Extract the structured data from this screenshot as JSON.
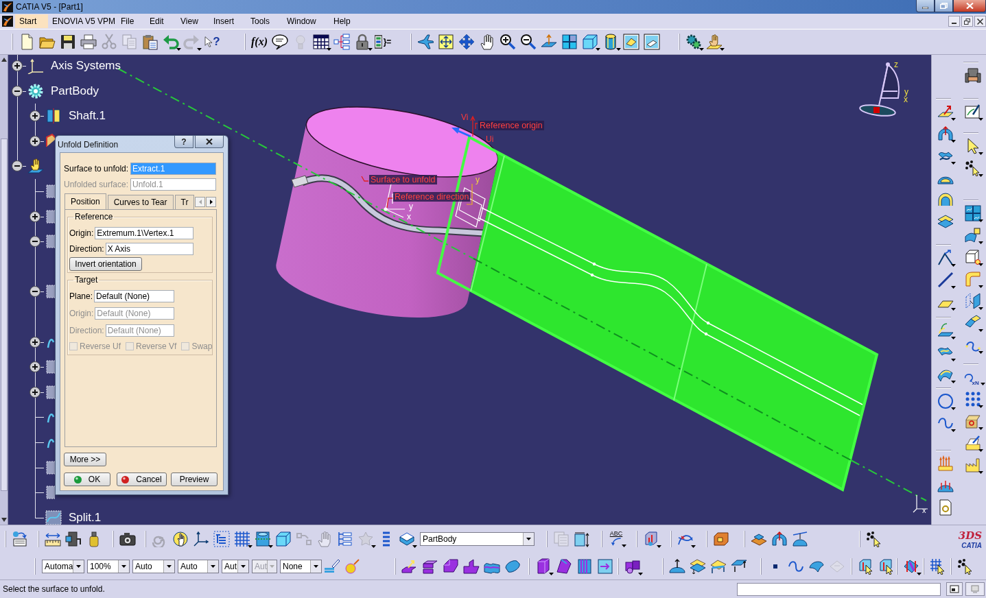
{
  "window": {
    "title": "CATIA V5 - [Part1]"
  },
  "menu": [
    {
      "label": "Start",
      "selected": true
    },
    {
      "label": "ENOVIA V5 VPM",
      "selected": false
    },
    {
      "label": "File",
      "selected": false
    },
    {
      "label": "Edit",
      "selected": false
    },
    {
      "label": "View",
      "selected": false
    },
    {
      "label": "Insert",
      "selected": false
    },
    {
      "label": "Tools",
      "selected": false
    },
    {
      "label": "Window",
      "selected": false
    },
    {
      "label": "Help",
      "selected": false
    }
  ],
  "top_toolbar": [
    {
      "tools": [
        {
          "kind": "new",
          "disabled": false,
          "dropdown": false
        },
        {
          "kind": "open",
          "disabled": false,
          "dropdown": false
        },
        {
          "kind": "save",
          "disabled": false,
          "dropdown": false
        },
        {
          "kind": "print",
          "disabled": false,
          "dropdown": false
        },
        {
          "kind": "cut",
          "disabled": true,
          "dropdown": false
        },
        {
          "kind": "copy",
          "disabled": true,
          "dropdown": false
        },
        {
          "kind": "paste",
          "disabled": false,
          "dropdown": false
        },
        {
          "kind": "undo",
          "disabled": false,
          "dropdown": true
        },
        {
          "kind": "redo",
          "disabled": true,
          "dropdown": true
        },
        {
          "kind": "whatsthis",
          "label": "?",
          "disabled": false,
          "dropdown": false
        }
      ]
    },
    {
      "tools": [
        {
          "kind": "formula",
          "label": "f(x)",
          "disabled": false,
          "dropdown": false
        },
        {
          "kind": "comment",
          "disabled": false,
          "dropdown": false
        },
        {
          "kind": "bulb",
          "disabled": true,
          "dropdown": false
        },
        {
          "kind": "table",
          "disabled": false,
          "dropdown": true
        },
        {
          "kind": "tree",
          "disabled": false,
          "dropdown": false
        },
        {
          "kind": "lock",
          "disabled": false,
          "dropdown": true
        },
        {
          "kind": "equation",
          "label": "}=",
          "disabled": false,
          "dropdown": false
        }
      ]
    },
    {
      "tools": [
        {
          "kind": "fly",
          "disabled": false,
          "dropdown": false
        },
        {
          "kind": "fit",
          "disabled": false,
          "dropdown": false
        },
        {
          "kind": "pan",
          "disabled": false,
          "dropdown": false
        },
        {
          "kind": "rotate",
          "disabled": false,
          "dropdown": false
        },
        {
          "kind": "zoomin",
          "disabled": false,
          "dropdown": false
        },
        {
          "kind": "zoomout",
          "disabled": false,
          "dropdown": false
        },
        {
          "kind": "normal",
          "disabled": false,
          "dropdown": false
        },
        {
          "kind": "views",
          "disabled": false,
          "dropdown": false
        },
        {
          "kind": "iso",
          "disabled": false,
          "dropdown": true
        },
        {
          "kind": "shade",
          "disabled": false,
          "dropdown": true
        },
        {
          "kind": "hide",
          "disabled": false,
          "dropdown": false
        },
        {
          "kind": "swap",
          "disabled": false,
          "dropdown": false
        }
      ]
    },
    {
      "tools": [
        {
          "kind": "gears",
          "disabled": false,
          "dropdown": true
        },
        {
          "kind": "handsheet",
          "disabled": false,
          "dropdown": true
        }
      ]
    }
  ],
  "tree": {
    "items": [
      {
        "kind": "axes",
        "label": "Axis Systems",
        "expanded": false
      },
      {
        "kind": "body",
        "label": "PartBody",
        "expanded": true,
        "children": [
          {
            "kind": "shaft",
            "label": "Shaft.1",
            "expanded": false
          },
          {
            "kind": "feature",
            "expanded": false
          }
        ]
      },
      {
        "kind": "geoset",
        "expanded": true,
        "children": [
          {
            "kind": "surface"
          },
          {
            "kind": "surface",
            "expanded": false
          },
          {
            "kind": "surface",
            "expanded": true
          },
          {
            "kind": "surface",
            "expanded": true
          },
          {
            "kind": "curve",
            "expanded": false
          },
          {
            "kind": "surface",
            "expanded": false
          },
          {
            "kind": "surface",
            "expanded": false
          },
          {
            "kind": "curve"
          },
          {
            "kind": "curve"
          },
          {
            "kind": "surface"
          },
          {
            "kind": "surface"
          },
          {
            "kind": "split",
            "label": "Split.1"
          }
        ]
      }
    ]
  },
  "viewport": {
    "annotations": [
      "Reference origin",
      "Surface to unfold",
      "Reference direction"
    ],
    "axis_labels": [
      "Vi",
      "Ui",
      "y",
      "y",
      "x"
    ],
    "compass": [
      "z",
      "y",
      "x"
    ],
    "corner_axis": [
      "x"
    ]
  },
  "dialog": {
    "title": "Unfold Definition",
    "help_button": "?",
    "fields": [
      {
        "label": "Surface to unfold:",
        "value": "Extract.1",
        "selected": true,
        "disabled": false
      },
      {
        "label": "Unfolded surface:",
        "value": "Unfold.1",
        "selected": false,
        "disabled": true
      }
    ],
    "tabs": [
      {
        "label": "Position",
        "selected": true
      },
      {
        "label": "Curves to Tear",
        "selected": false
      },
      {
        "label": "Tr",
        "selected": false
      }
    ],
    "tab_scroll": [
      {
        "kind": "left",
        "disabled": true
      },
      {
        "kind": "right",
        "disabled": false
      }
    ],
    "reference": {
      "title": "Reference",
      "fields": [
        {
          "label": "Origin:",
          "value": "Extremum.1\\Vertex.1",
          "disabled": false
        },
        {
          "label": "Direction:",
          "value": "X Axis",
          "disabled": false
        }
      ],
      "button": "Invert orientation"
    },
    "target": {
      "title": "Target",
      "fields": [
        {
          "label": "Plane:",
          "value": "Default (None)",
          "disabled": false
        },
        {
          "label": "Origin:",
          "value": "Default (None)",
          "disabled": true
        },
        {
          "label": "Direction:",
          "value": "Default (None)",
          "disabled": true
        }
      ],
      "checkboxes": [
        {
          "label": "Reverse Uf",
          "checked": false,
          "disabled": true
        },
        {
          "label": "Reverse Vf",
          "checked": false,
          "disabled": true
        },
        {
          "label": "Swap",
          "checked": false,
          "disabled": true
        }
      ]
    },
    "more_button": "More >>",
    "buttons": [
      {
        "label": "OK",
        "kind": "ok"
      },
      {
        "label": "Cancel",
        "kind": "cancel"
      },
      {
        "label": "Preview",
        "kind": "preview"
      }
    ]
  },
  "right_toolbar": {
    "columns": [
      [
        {
          "tools": [
            {
              "kind": "extrude",
              "disabled": false,
              "dropdown": true
            },
            {
              "kind": "revolve",
              "disabled": false,
              "dropdown": true
            },
            {
              "kind": "sweep",
              "disabled": false,
              "dropdown": true
            },
            {
              "kind": "dome",
              "disabled": false,
              "dropdown": false
            },
            {
              "kind": "offset",
              "disabled": false,
              "dropdown": false
            },
            {
              "kind": "stack",
              "disabled": false,
              "dropdown": false
            }
          ]
        },
        {
          "tools": [
            {
              "kind": "vertex",
              "disabled": false,
              "dropdown": true
            },
            {
              "kind": "line",
              "disabled": false,
              "dropdown": true
            },
            {
              "kind": "plane",
              "disabled": false,
              "dropdown": true
            }
          ]
        },
        {
          "tools": [
            {
              "kind": "project",
              "disabled": false,
              "dropdown": true
            },
            {
              "kind": "blend",
              "disabled": false,
              "dropdown": true
            },
            {
              "kind": "fill",
              "disabled": false,
              "dropdown": true
            }
          ]
        },
        {
          "tools": [
            {
              "kind": "circle",
              "disabled": false,
              "dropdown": true
            },
            {
              "kind": "spline",
              "disabled": false,
              "dropdown": true
            }
          ]
        },
        {
          "tools": [
            {
              "kind": "spikes",
              "disabled": false,
              "dropdown": false
            },
            {
              "kind": "domespikes",
              "disabled": false,
              "dropdown": false
            },
            {
              "kind": "report",
              "disabled": false,
              "dropdown": false
            }
          ]
        }
      ],
      [
        {
          "tools": [
            {
              "kind": "chair",
              "disabled": false,
              "dropdown": false
            }
          ]
        },
        {
          "tools": [
            {
              "kind": "sketch",
              "disabled": false,
              "dropdown": true
            }
          ]
        },
        {
          "tools": [
            {
              "kind": "select",
              "disabled": false,
              "dropdown": true
            },
            {
              "kind": "scatter",
              "disabled": false,
              "dropdown": true
            }
          ]
        },
        {
          "tools": [
            {
              "kind": "quad",
              "disabled": false,
              "dropdown": true
            },
            {
              "kind": "flagsheet",
              "disabled": false,
              "dropdown": true
            },
            {
              "kind": "cubetool",
              "disabled": false,
              "dropdown": true
            },
            {
              "kind": "bentsheet",
              "disabled": false,
              "dropdown": true
            },
            {
              "kind": "splitsheet",
              "disabled": false,
              "dropdown": true
            },
            {
              "kind": "joinsheet",
              "disabled": false,
              "dropdown": true
            },
            {
              "kind": "curve",
              "disabled": false,
              "dropdown": true
            }
          ]
        },
        {
          "tools": [
            {
              "kind": "repeat",
              "label": "xN",
              "disabled": false,
              "dropdown": true
            },
            {
              "kind": "dotgrid",
              "disabled": false,
              "dropdown": true
            },
            {
              "kind": "package",
              "disabled": false,
              "dropdown": true
            },
            {
              "kind": "tray",
              "disabled": false,
              "dropdown": true
            },
            {
              "kind": "factory",
              "disabled": false,
              "dropdown": true
            }
          ]
        }
      ]
    ]
  },
  "bottom_toolbar": {
    "rows": [
      [
        {
          "tools": [
            {
              "kind": "transfer",
              "disabled": false,
              "dropdown": false
            }
          ]
        },
        {
          "tools": [
            {
              "kind": "ruler",
              "disabled": false,
              "dropdown": false
            },
            {
              "kind": "inertia",
              "disabled": false,
              "dropdown": false
            },
            {
              "kind": "weight",
              "disabled": false,
              "dropdown": false
            }
          ]
        },
        {
          "tools": [
            {
              "kind": "camera",
              "disabled": false,
              "dropdown": false
            }
          ]
        },
        {
          "tools": [
            {
              "kind": "spiral",
              "disabled": true,
              "dropdown": false
            },
            {
              "kind": "handglobe",
              "disabled": false,
              "dropdown": false
            },
            {
              "kind": "axes",
              "disabled": false,
              "dropdown": false
            },
            {
              "kind": "specs",
              "disabled": false,
              "dropdown": false
            },
            {
              "kind": "grid",
              "disabled": false,
              "dropdown": true
            },
            {
              "kind": "cylframe",
              "disabled": false,
              "dropdown": true
            },
            {
              "kind": "iso",
              "disabled": false,
              "dropdown": false
            },
            {
              "kind": "constraint",
              "disabled": true,
              "dropdown": false
            },
            {
              "kind": "rotate",
              "disabled": true,
              "dropdown": false
            },
            {
              "kind": "treelist",
              "disabled": false,
              "dropdown": false
            },
            {
              "kind": "star",
              "disabled": true,
              "dropdown": true
            },
            {
              "kind": "bars",
              "disabled": false,
              "dropdown": false
            },
            {
              "kind": "book",
              "disabled": false,
              "dropdown": true
            },
            {
              "kind": "combo",
              "value": "PartBody",
              "disabled": false
            }
          ]
        },
        {
          "tools": [
            {
              "kind": "pages",
              "disabled": true,
              "dropdown": false
            },
            {
              "kind": "boxheight",
              "disabled": false,
              "dropdown": false
            }
          ]
        },
        {
          "tools": [
            {
              "kind": "annotate",
              "label": "ABC",
              "disabled": false,
              "dropdown": true
            }
          ]
        },
        {
          "tools": [
            {
              "kind": "cubepipe",
              "disabled": false,
              "dropdown": true
            }
          ]
        },
        {
          "tools": [
            {
              "kind": "curvecross",
              "disabled": false,
              "dropdown": true
            }
          ]
        },
        {
          "tools": [
            {
              "kind": "cutbox",
              "disabled": false,
              "dropdown": false
            }
          ]
        },
        {
          "tools": [
            {
              "kind": "tabsheet",
              "disabled": false,
              "dropdown": false
            },
            {
              "kind": "revolve",
              "disabled": false,
              "dropdown": false
            },
            {
              "kind": "domeline",
              "disabled": false,
              "dropdown": false
            }
          ]
        },
        {
          "tools": [
            {
              "kind": "scatter",
              "disabled": false,
              "dropdown": false
            }
          ]
        }
      ],
      [
        {
          "tools": [
            {
              "kind": "combo",
              "value": "Automa",
              "disabled": false
            },
            {
              "kind": "combo",
              "value": "100%",
              "disabled": false
            },
            {
              "kind": "combo",
              "value": "Auto",
              "disabled": false
            },
            {
              "kind": "combo",
              "value": "Auto",
              "disabled": false
            },
            {
              "kind": "combo",
              "value": "Aut",
              "disabled": false
            },
            {
              "kind": "combo",
              "value": "Aut",
              "disabled": true
            },
            {
              "kind": "combo",
              "value": "None",
              "disabled": false
            },
            {
              "kind": "brush",
              "disabled": false,
              "dropdown": false
            },
            {
              "kind": "wand",
              "disabled": false,
              "dropdown": false
            }
          ]
        },
        {
          "tools": [
            {
              "kind": "padarrow",
              "disabled": false,
              "dropdown": false
            },
            {
              "kind": "pocket",
              "disabled": false,
              "dropdown": false
            },
            {
              "kind": "ramp",
              "disabled": false,
              "dropdown": false
            },
            {
              "kind": "step",
              "disabled": false,
              "dropdown": false
            },
            {
              "kind": "slab",
              "disabled": false,
              "dropdown": false
            },
            {
              "kind": "roundslab",
              "disabled": false,
              "dropdown": false
            }
          ]
        },
        {
          "tools": [
            {
              "kind": "prism",
              "disabled": false,
              "dropdown": true
            },
            {
              "kind": "bevel",
              "disabled": false,
              "dropdown": false
            },
            {
              "kind": "comb",
              "disabled": false,
              "dropdown": false
            },
            {
              "kind": "framedarrow",
              "disabled": false,
              "dropdown": false
            }
          ]
        },
        {
          "tools": [
            {
              "kind": "blocks",
              "disabled": false,
              "dropdown": true
            }
          ]
        },
        {
          "tools": [
            {
              "kind": "domearrow",
              "disabled": false,
              "dropdown": false
            },
            {
              "kind": "sheets",
              "disabled": false,
              "dropdown": false
            },
            {
              "kind": "sheetflag",
              "disabled": false,
              "dropdown": false
            },
            {
              "kind": "sheetarrows",
              "disabled": false,
              "dropdown": false
            }
          ]
        },
        {
          "tools": [
            {
              "kind": "dot",
              "disabled": false,
              "dropdown": false
            },
            {
              "kind": "spline",
              "disabled": false,
              "dropdown": false
            },
            {
              "kind": "capsurf",
              "disabled": false,
              "dropdown": false
            },
            {
              "kind": "greybox",
              "disabled": true,
              "dropdown": false
            }
          ]
        },
        {
          "tools": [
            {
              "kind": "pointbox",
              "disabled": false,
              "dropdown": false
            },
            {
              "kind": "pointbox",
              "disabled": false,
              "dropdown": false
            }
          ]
        },
        {
          "tools": [
            {
              "kind": "pipes",
              "disabled": false,
              "dropdown": true
            }
          ]
        },
        {
          "tools": [
            {
              "kind": "gridpoint",
              "disabled": false,
              "dropdown": false
            }
          ]
        },
        {
          "tools": [
            {
              "kind": "scatter",
              "disabled": false,
              "dropdown": false
            }
          ]
        }
      ]
    ]
  },
  "logo": {
    "brand": "3DS",
    "product": "CATIA"
  },
  "status_bar": {
    "message": "Select the surface to unfold."
  }
}
